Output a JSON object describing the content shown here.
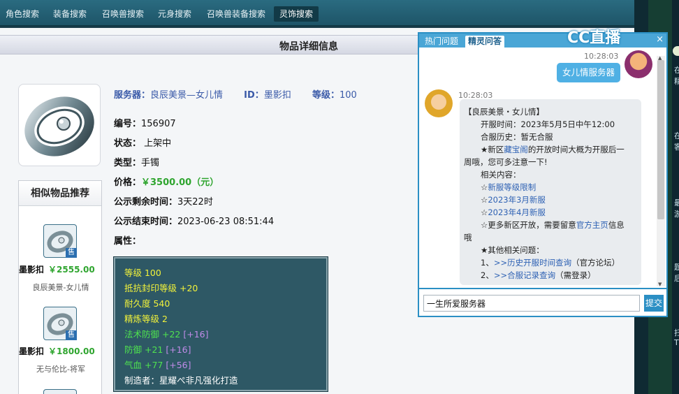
{
  "nav": {
    "tabs": [
      "角色搜索",
      "装备搜索",
      "召唤兽搜索",
      "元身搜索",
      "召唤兽装备搜索",
      "灵饰搜索"
    ],
    "active_index": 5
  },
  "page_title": "物品详细信息",
  "item": {
    "server_label": "服务器：",
    "server_value": "良辰美景—女儿情",
    "id_label": "ID：",
    "id_value": "墨影扣",
    "level_label": "等级：",
    "level_value": "100",
    "number_label": "编号：",
    "number_value": "156907",
    "status_label": "状态：",
    "status_value": "上架中",
    "type_label": "类型：",
    "type_value": "手镯",
    "price_label": "价格：",
    "price_value": "￥3500.00（元）",
    "remaining_label": "公示剩余时间：",
    "remaining_value": "3天22时",
    "end_label": "公示结束时间：",
    "end_value": "2023-06-23 08:51:44",
    "attr_label": "属性："
  },
  "attributes": [
    {
      "text": "等级 100",
      "extra": "",
      "color": "yel"
    },
    {
      "text": "抵抗封印等级 +20",
      "extra": "",
      "color": "yel"
    },
    {
      "text": "耐久度 540",
      "extra": "",
      "color": "yel"
    },
    {
      "text": "精炼等级 2",
      "extra": "",
      "color": "yel"
    },
    {
      "text": "法术防御 +22",
      "extra": "[+16]",
      "color": "grn"
    },
    {
      "text": "防御 +21",
      "extra": "[+16]",
      "color": "grn"
    },
    {
      "text": "气血 +77",
      "extra": "[+56]",
      "color": "grn"
    },
    {
      "text": "制造者：星耀ぺ非凡强化打造",
      "extra": "",
      "color": "wht"
    }
  ],
  "similar": {
    "title": "相似物品推荐",
    "sale_badge": "售",
    "items": [
      {
        "name": "墨影扣",
        "price": "￥2555.00",
        "server": "良辰美景-女儿情"
      },
      {
        "name": "墨影扣",
        "price": "￥1800.00",
        "server": "无与伦比-将军"
      }
    ]
  },
  "chat": {
    "tabs": [
      "热门问题",
      "精灵问答"
    ],
    "active_tab": 1,
    "close": "×",
    "logo_text": "CC直播",
    "user_time": "10:28:03",
    "user_message": "女儿情服务器",
    "bot_time": "10:28:03",
    "reply": {
      "line1": "【良辰美景・女儿情】",
      "line2": "开服时间：2023年5月5日中午12:00",
      "line3": "合服历史：暂无合服",
      "line4a": "★新区",
      "line4link": "藏宝阁",
      "line4b": "的开放时间大概为开服后一",
      "line5": "周哦，您可多注意一下!",
      "line6": "相关内容：",
      "line7a": "☆",
      "line7link": "新服等级限制",
      "line8a": "☆",
      "line8link": "2023年3月新服",
      "line9a": "☆",
      "line9link": "2023年4月新服",
      "line10a": "☆更多新区开放，需要留意",
      "line10link": "官方主页",
      "line10b": "信息",
      "line11": "哦",
      "line12": "★其他相关问题：",
      "line13a": "1、",
      "line13link": ">>历史开服时间查询",
      "line13b": "（官方论坛）",
      "line14a": "2、",
      "line14link": ">>合服记录查询",
      "line14b": "（需登录）"
    },
    "input_value": "一生所爱服务器",
    "submit": "提交"
  },
  "edge": {
    "labels": [
      "在",
      "精",
      "在",
      "客",
      "最",
      "游",
      "题",
      "后",
      "扫",
      "T"
    ]
  }
}
